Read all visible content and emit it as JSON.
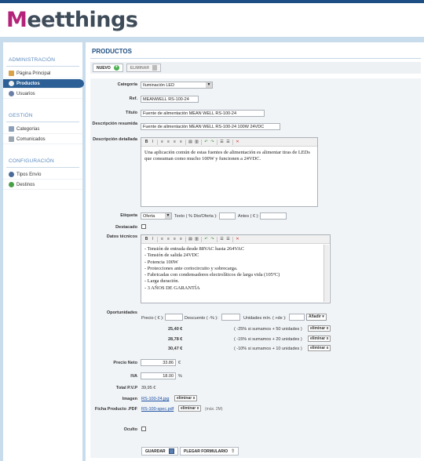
{
  "app": {
    "logo_letter": "M",
    "logo_rest": "eetthings"
  },
  "sidebar": {
    "sections": [
      {
        "title": "ADMINISTRACIÓN",
        "items": [
          "Página Principal",
          "Productos",
          "Usuarios"
        ]
      },
      {
        "title": "GESTIÓN",
        "items": [
          "Categorías",
          "Comunicados"
        ]
      },
      {
        "title": "CONFIGURACIÓN",
        "items": [
          "Tipos Envío",
          "Destinos"
        ]
      }
    ],
    "active": "Productos"
  },
  "page": {
    "title": "PRODUCTOS"
  },
  "toolbar": {
    "new_label": "NUEVO",
    "delete_label": "ELIMINAR"
  },
  "form": {
    "categoria": {
      "label": "Categoría",
      "value": "Iluminación LED"
    },
    "ref": {
      "label": "Ref.",
      "value": "MEANWELL RS-100-24"
    },
    "titulo": {
      "label": "Título",
      "value": "Fuente de alimentación MEAN WELL RS-100-24"
    },
    "desc_resumida": {
      "label": "Descripción resumida",
      "value": "Fuente de alimentación MEAN WELL RS-100-24 100W 24VDC"
    },
    "desc_detallada": {
      "label": "Descripción detallada",
      "value": "Una aplicación común de estas fuentes de alimentación es alimentar tiras de LEDs que consuman como mucho 100W y funcionen a 24VDC."
    },
    "etiqueta": {
      "label": "Etiqueta",
      "value": "Oferta",
      "texto_label": "Texto ( % Dto/Oferta ):",
      "antes_label": "Antes ( € ):"
    },
    "destacado": {
      "label": "Destacado"
    },
    "datos_tecnicos": {
      "label": "Datos técnicos",
      "lines": [
        "- Tensión de entrada desde 88VAC hasta 264VAC",
        "- Tensión de salida 24VDC",
        "- Potencia 100W",
        "- Protecciones ante cortocircuito y sobrecarga.",
        "- Fabricadas con condensadores electrolíticos de larga vida (105ºC)",
        "- Larga duración.",
        "- 3 AÑOS DE GARANTÍA"
      ]
    },
    "oportunidades": {
      "label": "Oportunidades",
      "precio_label": "Precio ( € ):",
      "descuento_label": "Descuento ( -% ):",
      "unidades_label": "Unidades mín. ( +de ):",
      "add_label": "Añadir",
      "rows": [
        {
          "price": "25,40 €",
          "text": "( -25% si sumamos + 50 unidades )",
          "remove": "eliminar x"
        },
        {
          "price": "28,78 €",
          "text": "( -15% si sumamos + 20 unidades )",
          "remove": "eliminar x"
        },
        {
          "price": "30,47 €",
          "text": "( -10% si sumamos + 10 unidades )",
          "remove": "eliminar x"
        }
      ]
    },
    "precio_neto": {
      "label": "Precio Neto",
      "value": "33.86",
      "unit": "€"
    },
    "iva": {
      "label": "IVA",
      "value": "18.00",
      "unit": "%"
    },
    "total_pvp": {
      "label": "Total P.V.P",
      "value": "39,95 €"
    },
    "imagen": {
      "label": "Imagen",
      "file": "RS-100-24.jpg",
      "remove": "eliminar x"
    },
    "ficha": {
      "label": "Ficha Producto .PDF",
      "file": "RS-100-spec.pdf",
      "remove": "eliminar x",
      "note": "(máx. 2M)"
    },
    "oculto": {
      "label": "Oculto"
    }
  },
  "footer": {
    "save_label": "GUARDAR",
    "fold_label": "PLEGAR FORMULARIO"
  },
  "colors": {
    "accent": "#1f4f82",
    "brand": "#b4237a",
    "active_nav": "#2b5f95"
  }
}
